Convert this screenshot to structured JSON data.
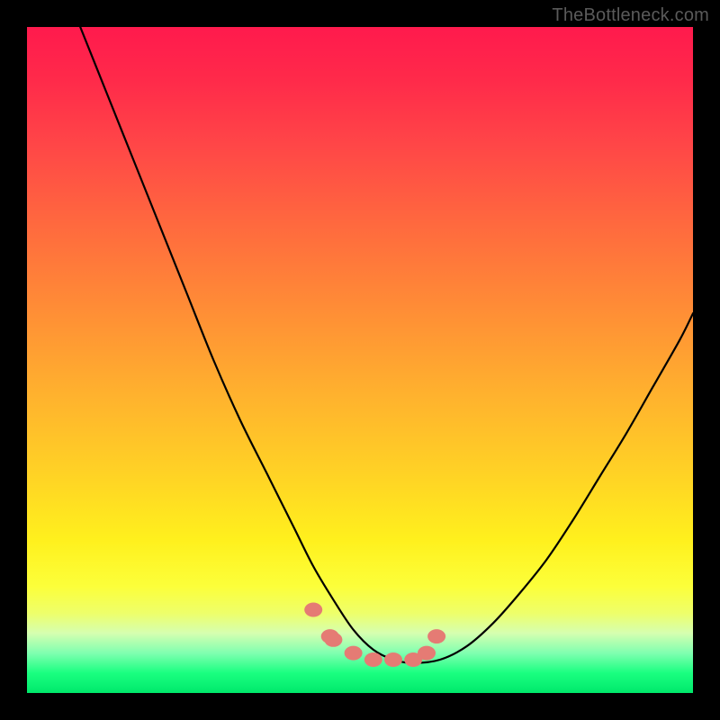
{
  "watermark": "TheBottleneck.com",
  "chart_data": {
    "type": "line",
    "title": "",
    "xlabel": "",
    "ylabel": "",
    "xlim": [
      0,
      100
    ],
    "ylim": [
      0,
      100
    ],
    "series": [
      {
        "name": "bottleneck-curve",
        "color": "#000000",
        "x": [
          8,
          12,
          16,
          20,
          24,
          28,
          32,
          36,
          40,
          43,
          46,
          49,
          52,
          55,
          58,
          62,
          66,
          70,
          74,
          78,
          82,
          86,
          90,
          94,
          98,
          100
        ],
        "values": [
          100,
          90,
          80,
          70,
          60,
          50,
          41,
          33,
          25,
          19,
          14,
          9.5,
          6.5,
          5,
          4.5,
          5,
          7,
          10.5,
          15,
          20,
          26,
          32.5,
          39,
          46,
          53,
          57
        ]
      }
    ],
    "marker_points": {
      "name": "bottom-markers",
      "color": "#e57b74",
      "x": [
        43,
        45.5,
        46,
        49,
        52,
        55,
        58,
        60,
        61.5
      ],
      "values": [
        12.5,
        8.5,
        8,
        6,
        5,
        5,
        5,
        6,
        8.5
      ]
    }
  },
  "colors": {
    "frame": "#000000",
    "curve": "#000000",
    "markers": "#e57b74"
  }
}
